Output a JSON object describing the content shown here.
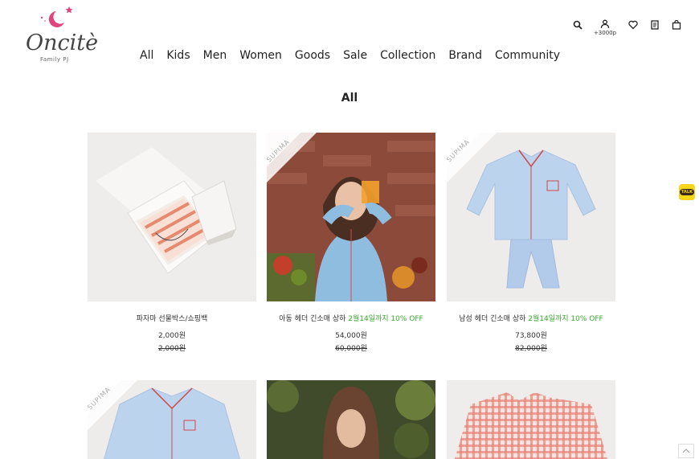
{
  "brand": {
    "name": "Oncitè",
    "tagline": "Family PJ"
  },
  "nav": [
    {
      "label": "All"
    },
    {
      "label": "Kids"
    },
    {
      "label": "Men"
    },
    {
      "label": "Women"
    },
    {
      "label": "Goods"
    },
    {
      "label": "Sale"
    },
    {
      "label": "Collection"
    },
    {
      "label": "Brand"
    },
    {
      "label": "Community"
    }
  ],
  "tools": {
    "search_icon": "search-icon",
    "user_icon": "user-icon",
    "points": "+3000p",
    "wishlist_icon": "heart-icon",
    "orders_icon": "document-icon",
    "cart_icon": "bag-icon"
  },
  "page_title": "All",
  "products": [
    {
      "name": "파자마 선물박스/쇼핑백",
      "promo": "",
      "price": "2,000원",
      "original": "2,000원",
      "badge": ""
    },
    {
      "name": "아동 헤더 긴소매 상하 ",
      "promo": "2월14일까지 10% OFF",
      "price": "54,000원",
      "original": "60,000원",
      "badge": "SUPIMA"
    },
    {
      "name": "남성 헤더 긴소매 상하 ",
      "promo": "2월14일까지 10% OFF",
      "price": "73,800원",
      "original": "82,000원",
      "badge": "SUPIMA"
    },
    {
      "name": "",
      "promo": "",
      "price": "",
      "original": "",
      "badge": "SUPIMA"
    },
    {
      "name": "",
      "promo": "",
      "price": "",
      "original": "",
      "badge": ""
    },
    {
      "name": "",
      "promo": "",
      "price": "",
      "original": "",
      "badge": ""
    }
  ],
  "kakao": {
    "label": "TALK"
  },
  "colors": {
    "promo": "#3aa82e",
    "kakao": "#f7d518",
    "logo_accent": "#e0457b"
  }
}
